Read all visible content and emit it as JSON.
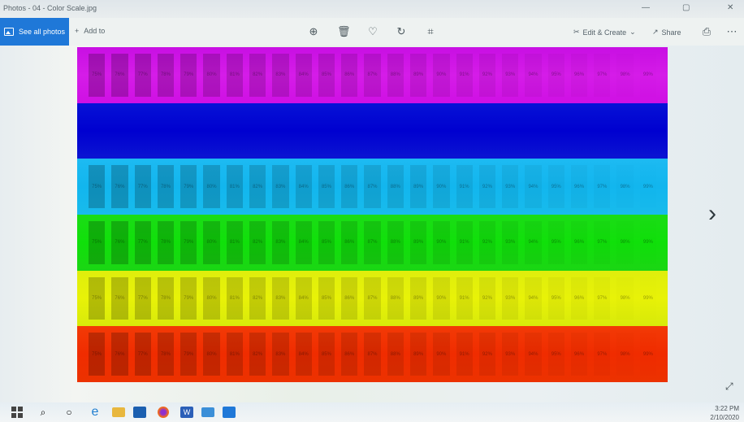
{
  "window": {
    "title": "Photos - 04 - Color Scale.jpg",
    "minimize": "—",
    "maximize": "▢",
    "close": "✕"
  },
  "toolbar": {
    "see_all_label": "See all photos",
    "add_to_label": "Add to",
    "edit_create_label": "Edit & Create",
    "share_label": "Share",
    "icons": [
      "zoom-in-icon",
      "delete-icon",
      "favorite-icon",
      "rotate-icon",
      "crop-icon"
    ]
  },
  "image": {
    "bands": [
      {
        "color": "magenta",
        "labels": [
          "75%",
          "76%",
          "77%",
          "78%",
          "79%",
          "80%",
          "81%",
          "82%",
          "83%",
          "84%",
          "85%",
          "86%",
          "87%",
          "88%",
          "89%",
          "90%",
          "91%",
          "92%",
          "93%",
          "94%",
          "95%",
          "96%",
          "97%",
          "98%",
          "99%"
        ]
      },
      {
        "color": "blue",
        "labels": []
      },
      {
        "color": "cyan",
        "labels": [
          "75%",
          "76%",
          "77%",
          "78%",
          "79%",
          "80%",
          "81%",
          "82%",
          "83%",
          "84%",
          "85%",
          "86%",
          "87%",
          "88%",
          "89%",
          "90%",
          "91%",
          "92%",
          "93%",
          "94%",
          "95%",
          "96%",
          "97%",
          "98%",
          "99%"
        ]
      },
      {
        "color": "green",
        "labels": [
          "75%",
          "76%",
          "77%",
          "78%",
          "79%",
          "80%",
          "81%",
          "82%",
          "83%",
          "84%",
          "85%",
          "86%",
          "87%",
          "88%",
          "89%",
          "90%",
          "91%",
          "92%",
          "93%",
          "94%",
          "95%",
          "96%",
          "97%",
          "98%",
          "99%"
        ]
      },
      {
        "color": "yellow",
        "labels": [
          "75%",
          "76%",
          "77%",
          "78%",
          "79%",
          "80%",
          "81%",
          "82%",
          "83%",
          "84%",
          "85%",
          "86%",
          "87%",
          "88%",
          "89%",
          "90%",
          "91%",
          "92%",
          "93%",
          "94%",
          "95%",
          "96%",
          "97%",
          "98%",
          "99%"
        ]
      },
      {
        "color": "red",
        "labels": [
          "75%",
          "76%",
          "77%",
          "78%",
          "79%",
          "80%",
          "81%",
          "82%",
          "83%",
          "84%",
          "85%",
          "86%",
          "87%",
          "88%",
          "89%",
          "90%",
          "91%",
          "92%",
          "93%",
          "94%",
          "95%",
          "96%",
          "97%",
          "98%",
          "99%"
        ]
      }
    ]
  },
  "nav": {
    "next_arrow": "›",
    "expand_icon": "⤢"
  },
  "taskbar": {
    "icons": [
      "windows-start-icon",
      "search-icon",
      "task-view-icon",
      "edge-icon",
      "file-explorer-icon",
      "outlook-icon",
      "firefox-icon",
      "word-icon",
      "remote-desktop-icon",
      "photos-icon"
    ],
    "time": "3:22 PM",
    "date": "2/10/2020"
  }
}
